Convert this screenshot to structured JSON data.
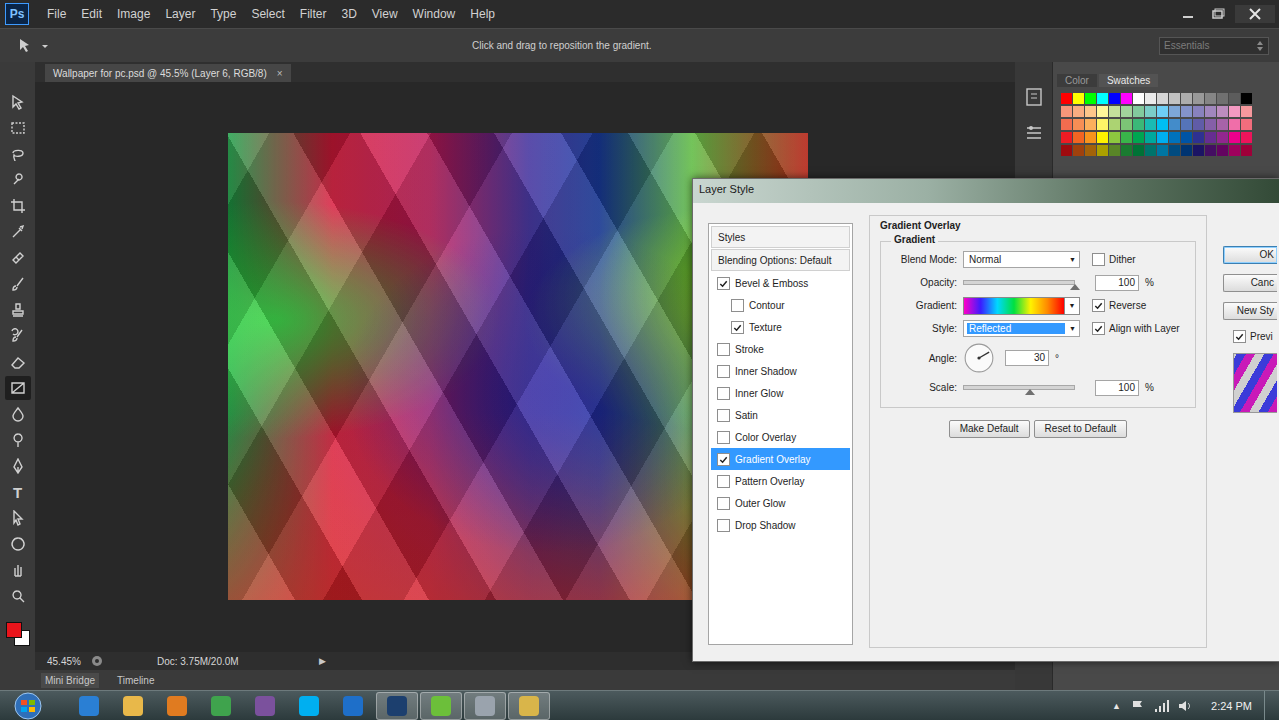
{
  "app": {
    "logo": "Ps",
    "menu": [
      "File",
      "Edit",
      "Image",
      "Layer",
      "Type",
      "Select",
      "Filter",
      "3D",
      "View",
      "Window",
      "Help"
    ]
  },
  "options_bar": {
    "hint": "Click and drag to reposition the gradient.",
    "workspace": "Essentials"
  },
  "document": {
    "tab": "Wallpaper for pc.psd @ 45.5% (Layer 6, RGB/8)",
    "close": "×",
    "zoom": "45.45%",
    "doc_info": "Doc: 3.75M/20.0M",
    "arrow": "▶"
  },
  "toolbar": {
    "tools": [
      {
        "kind": "move",
        "selected": false
      },
      {
        "kind": "marquee",
        "selected": false
      },
      {
        "kind": "lasso",
        "selected": false
      },
      {
        "kind": "quick-select",
        "selected": false
      },
      {
        "kind": "crop",
        "selected": false
      },
      {
        "kind": "eyedropper",
        "selected": false
      },
      {
        "kind": "healing",
        "selected": false
      },
      {
        "kind": "brush",
        "selected": false
      },
      {
        "kind": "stamp",
        "selected": false
      },
      {
        "kind": "history-brush",
        "selected": false
      },
      {
        "kind": "eraser",
        "selected": false
      },
      {
        "kind": "gradient",
        "selected": true
      },
      {
        "kind": "blur",
        "selected": false
      },
      {
        "kind": "dodge",
        "selected": false
      },
      {
        "kind": "pen",
        "selected": false
      },
      {
        "kind": "type",
        "selected": false,
        "glyph": "T"
      },
      {
        "kind": "path-select",
        "selected": false
      },
      {
        "kind": "shape",
        "selected": false
      },
      {
        "kind": "hand",
        "selected": false
      },
      {
        "kind": "zoom",
        "selected": false
      }
    ],
    "foreground": "#e8141b",
    "background": "#ffffff"
  },
  "panel_tabs": [
    {
      "label": "Color",
      "selected": false
    },
    {
      "label": "Swatches",
      "selected": true
    }
  ],
  "swatches": [
    [
      "#ff0000",
      "#ffff00",
      "#00ff00",
      "#00ffff",
      "#0000ff",
      "#ff00ff",
      "#ffffff",
      "#ebebeb",
      "#d6d6d6",
      "#c2c2c2",
      "#adadad",
      "#999999",
      "#858585",
      "#707070",
      "#5c5c5c",
      "#000000"
    ],
    [
      "#f7977a",
      "#f9ad81",
      "#fdc68a",
      "#fff79a",
      "#c4df9b",
      "#a2d39c",
      "#82ca9d",
      "#7bcdc8",
      "#6ecff6",
      "#7ea7d8",
      "#8493ca",
      "#8882be",
      "#a187be",
      "#bc8dbf",
      "#f49ac2",
      "#f6989d"
    ],
    [
      "#f26c4f",
      "#f68e55",
      "#fbaf5c",
      "#fff467",
      "#acd372",
      "#7cc576",
      "#3bb878",
      "#1abbb4",
      "#00bff3",
      "#438cca",
      "#5574b9",
      "#605ca8",
      "#855fa8",
      "#a763a8",
      "#f06ea9",
      "#f26d7d"
    ],
    [
      "#ed1c24",
      "#f26522",
      "#f7941d",
      "#fff200",
      "#8dc73f",
      "#39b54a",
      "#00a651",
      "#00a99d",
      "#00aeef",
      "#0072bc",
      "#0054a6",
      "#2e3192",
      "#662d91",
      "#92278f",
      "#ec008c",
      "#ed145b"
    ],
    [
      "#9e0b0f",
      "#a0410d",
      "#a36209",
      "#aba000",
      "#598527",
      "#1a7b30",
      "#007236",
      "#00746b",
      "#0076a3",
      "#004b80",
      "#003471",
      "#1b1464",
      "#440e62",
      "#630460",
      "#9e005d",
      "#9e0039"
    ]
  ],
  "bottom_tabs": [
    "Mini Bridge",
    "Timeline"
  ],
  "dialog": {
    "title": "Layer Style",
    "styles": [
      {
        "label": "Styles",
        "kind": "header",
        "checked": false,
        "selected": false
      },
      {
        "label": "Blending Options: Default",
        "kind": "header",
        "checked": false,
        "selected": false
      },
      {
        "label": "Bevel & Emboss",
        "kind": "effect",
        "checked": true,
        "selected": false
      },
      {
        "label": "Contour",
        "kind": "sub",
        "checked": false,
        "selected": false
      },
      {
        "label": "Texture",
        "kind": "sub",
        "checked": true,
        "selected": false
      },
      {
        "label": "Stroke",
        "kind": "effect",
        "checked": false,
        "selected": false
      },
      {
        "label": "Inner Shadow",
        "kind": "effect",
        "checked": false,
        "selected": false
      },
      {
        "label": "Inner Glow",
        "kind": "effect",
        "checked": false,
        "selected": false
      },
      {
        "label": "Satin",
        "kind": "effect",
        "checked": false,
        "selected": false
      },
      {
        "label": "Color Overlay",
        "kind": "effect",
        "checked": false,
        "selected": false
      },
      {
        "label": "Gradient Overlay",
        "kind": "effect",
        "checked": true,
        "selected": true
      },
      {
        "label": "Pattern Overlay",
        "kind": "effect",
        "checked": false,
        "selected": false
      },
      {
        "label": "Outer Glow",
        "kind": "effect",
        "checked": false,
        "selected": false
      },
      {
        "label": "Drop Shadow",
        "kind": "effect",
        "checked": false,
        "selected": false
      }
    ],
    "section": {
      "title": "Gradient Overlay",
      "group": "Gradient",
      "blend_mode": {
        "label": "Blend Mode:",
        "value": "Normal",
        "arrow": "▼"
      },
      "dither": {
        "label": "Dither",
        "checked": false
      },
      "opacity": {
        "label": "Opacity:",
        "value": "100",
        "unit": "%",
        "level": 1.0
      },
      "gradient": {
        "label": "Gradient:",
        "stops": [
          "#ff00c8",
          "#3b1cff",
          "#00d8ff",
          "#00e040",
          "#fff200",
          "#ff8a00",
          "#ff0000"
        ],
        "arrow": "▼"
      },
      "reverse": {
        "label": "Reverse",
        "checked": true
      },
      "style": {
        "label": "Style:",
        "value": "Reflected",
        "arrow": "▼"
      },
      "align": {
        "label": "Align with Layer",
        "checked": true
      },
      "angle": {
        "label": "Angle:",
        "value": "30",
        "unit": "°",
        "degrees": 30
      },
      "scale": {
        "label": "Scale:",
        "value": "100",
        "unit": "%",
        "level": 0.6
      },
      "buttons": [
        "Make Default",
        "Reset to Default"
      ]
    },
    "side_buttons": [
      {
        "label": "OK",
        "default": true
      },
      {
        "label": "Canc",
        "default": false
      },
      {
        "label": "New Sty",
        "default": false
      }
    ],
    "preview": {
      "label": "Previ",
      "checked": true
    }
  },
  "taskbar": {
    "apps": [
      {
        "color": "#2a7fd4",
        "selected": false
      },
      {
        "color": "#e8b84a",
        "selected": false
      },
      {
        "color": "#e07b20",
        "selected": false
      },
      {
        "color": "#3fa34d",
        "selected": false
      },
      {
        "color": "#7b519d",
        "selected": false
      },
      {
        "color": "#00aff0",
        "selected": false
      },
      {
        "color": "#1e6fc9",
        "selected": false
      },
      {
        "color": "#1c3f6e",
        "selected": true
      },
      {
        "color": "#6cbf3a",
        "selected": true
      },
      {
        "color": "#9aa3ad",
        "selected": true
      },
      {
        "color": "#d9b54a",
        "selected": true
      }
    ],
    "tray_arrow": "▲",
    "time": "2:24 PM"
  }
}
